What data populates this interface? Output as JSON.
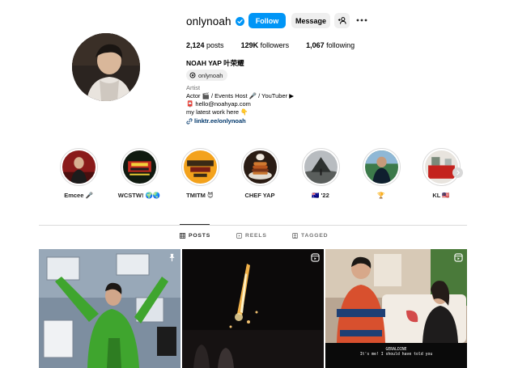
{
  "profile": {
    "username": "onlynoah",
    "follow_label": "Follow",
    "message_label": "Message",
    "adduser_label": "+R",
    "posts_count": "2,124",
    "posts_label": "posts",
    "followers_count": "129K",
    "followers_label": "followers",
    "following_count": "1,067",
    "following_label": "following",
    "full_name": "NOAH YAP 叶荣耀",
    "threads_handle": "onlynoah",
    "category": "Artist",
    "bio_line1": "Actor 🎬 / Events Host 🎤 / YouTuber ▶",
    "bio_line2": "📮 hello@noahyap.com",
    "bio_line3": "my latest work here 👇",
    "link_text": "linktr.ee/onlynoah",
    "colors": {
      "accent": "#0095f6",
      "link": "#00376b",
      "verified": "#0095f6"
    }
  },
  "highlights": [
    {
      "label": "Emcee 🎤"
    },
    {
      "label": "WCSTW! 🌍🌏"
    },
    {
      "label": "TMITM 😈"
    },
    {
      "label": "CHEF YAP"
    },
    {
      "label": "🇦🇺 '22"
    },
    {
      "label": "🏆"
    },
    {
      "label": "KL 🇲🇾"
    }
  ],
  "tabs": [
    {
      "label": "POSTS",
      "icon": "grid-icon",
      "active": true
    },
    {
      "label": "REELS",
      "icon": "reels-icon",
      "active": false
    },
    {
      "label": "TAGGED",
      "icon": "tagged-icon",
      "active": false
    }
  ],
  "posts": [
    {
      "badge": "pin-icon"
    },
    {
      "badge": "reel-icon"
    },
    {
      "badge": "reel-icon",
      "subtitle_name": "GERALDINE",
      "subtitle_text": "It's me! I should have told you"
    }
  ]
}
